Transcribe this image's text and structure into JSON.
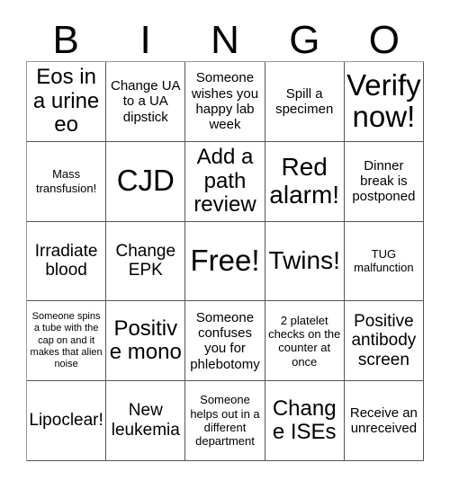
{
  "card": {
    "title": "BINGO",
    "header_letters": [
      "B",
      "I",
      "N",
      "G",
      "O"
    ],
    "columns": 5,
    "rows": 5,
    "text_color": "#000000",
    "border_color": "#555555",
    "background_color": "#ffffff",
    "free_space_label": "Free!",
    "free_space_index": 12,
    "cells": [
      {
        "text": "Eos in a urine eo",
        "size": "lg"
      },
      {
        "text": "Change UA to a UA dipstick",
        "size": "sm"
      },
      {
        "text": "Someone wishes you happy lab week",
        "size": "sm"
      },
      {
        "text": "Spill a specimen",
        "size": "sm"
      },
      {
        "text": "Verify now!",
        "size": "xxl"
      },
      {
        "text": "Mass transfusion!",
        "size": "xs"
      },
      {
        "text": "CJD",
        "size": "xxl"
      },
      {
        "text": "Add a path review",
        "size": "lg"
      },
      {
        "text": "Red alarm!",
        "size": "xl"
      },
      {
        "text": "Dinner break is postponed",
        "size": "sm"
      },
      {
        "text": "Irradiate blood",
        "size": "md"
      },
      {
        "text": "Change EPK",
        "size": "md"
      },
      {
        "text": "Free!",
        "size": "xxl"
      },
      {
        "text": "Twins!",
        "size": "xl"
      },
      {
        "text": "TUG malfunction",
        "size": "xs"
      },
      {
        "text": "Someone spins a tube with the cap on and it makes that alien noise",
        "size": "xxs"
      },
      {
        "text": "Positive mono",
        "size": "lg"
      },
      {
        "text": "Someone confuses you for phlebotomy",
        "size": "sm"
      },
      {
        "text": "2 platelet checks on the counter at once",
        "size": "xs"
      },
      {
        "text": "Positive antibody screen",
        "size": "md"
      },
      {
        "text": "Lipoclear!",
        "size": "md"
      },
      {
        "text": "New leukemia",
        "size": "md"
      },
      {
        "text": "Someone helps out in a different department",
        "size": "xs"
      },
      {
        "text": "Change ISEs",
        "size": "lg"
      },
      {
        "text": "Receive an unreceived",
        "size": "sm"
      }
    ]
  }
}
